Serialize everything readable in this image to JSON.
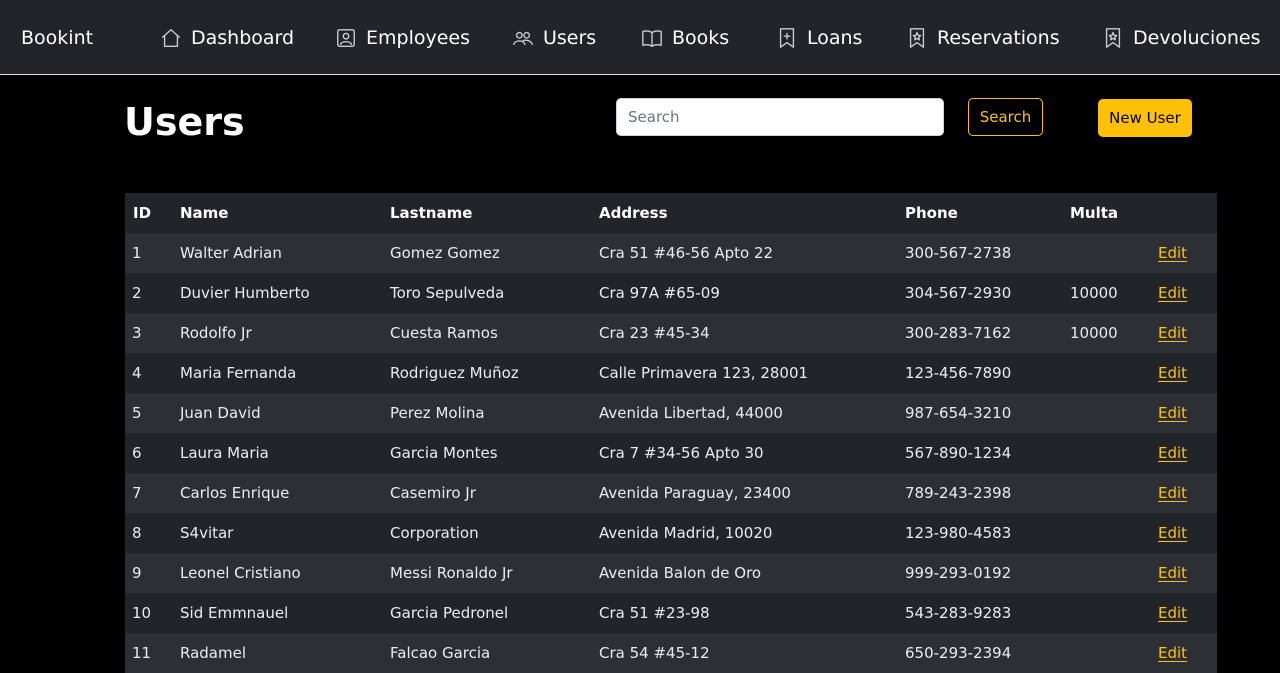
{
  "brand": "Bookint",
  "nav": [
    {
      "label": "Dashboard",
      "icon": "home-icon"
    },
    {
      "label": "Employees",
      "icon": "person-badge-icon"
    },
    {
      "label": "Users",
      "icon": "people-icon"
    },
    {
      "label": "Books",
      "icon": "book-icon"
    },
    {
      "label": "Loans",
      "icon": "bookmark-plus-icon"
    },
    {
      "label": "Reservations",
      "icon": "bookmark-star-icon"
    },
    {
      "label": "Devoluciones",
      "icon": "bookmark-star-icon"
    }
  ],
  "page_title": "Users",
  "search": {
    "placeholder": "Search",
    "value": "",
    "button_label": "Search"
  },
  "new_user_label": "New User",
  "colors": {
    "accent": "#ffc107",
    "navbar": "#212529",
    "row_odd": "#2c3034",
    "row_even": "#212529"
  },
  "table": {
    "headers": [
      "ID",
      "Name",
      "Lastname",
      "Address",
      "Phone",
      "Multa",
      ""
    ],
    "rows": [
      {
        "id": "1",
        "name": "Walter Adrian",
        "lastname": "Gomez Gomez",
        "address": "Cra 51 #46-56 Apto 22",
        "phone": "300-567-2738",
        "multa": "",
        "action": "Edit"
      },
      {
        "id": "2",
        "name": "Duvier Humberto",
        "lastname": "Toro Sepulveda",
        "address": "Cra 97A #65-09",
        "phone": "304-567-2930",
        "multa": "10000",
        "action": "Edit"
      },
      {
        "id": "3",
        "name": "Rodolfo Jr",
        "lastname": "Cuesta Ramos",
        "address": "Cra 23 #45-34",
        "phone": "300-283-7162",
        "multa": "10000",
        "action": "Edit"
      },
      {
        "id": "4",
        "name": "Maria Fernanda",
        "lastname": "Rodriguez Muñoz",
        "address": "Calle Primavera 123, 28001",
        "phone": "123-456-7890",
        "multa": "",
        "action": "Edit"
      },
      {
        "id": "5",
        "name": "Juan David",
        "lastname": "Perez Molina",
        "address": "Avenida Libertad, 44000",
        "phone": "987-654-3210",
        "multa": "",
        "action": "Edit"
      },
      {
        "id": "6",
        "name": "Laura Maria",
        "lastname": "Garcia Montes",
        "address": "Cra 7 #34-56 Apto 30",
        "phone": "567-890-1234",
        "multa": "",
        "action": "Edit"
      },
      {
        "id": "7",
        "name": "Carlos Enrique",
        "lastname": "Casemiro Jr",
        "address": "Avenida Paraguay, 23400",
        "phone": "789-243-2398",
        "multa": "",
        "action": "Edit"
      },
      {
        "id": "8",
        "name": "S4vitar",
        "lastname": "Corporation",
        "address": "Avenida Madrid, 10020",
        "phone": "123-980-4583",
        "multa": "",
        "action": "Edit"
      },
      {
        "id": "9",
        "name": "Leonel Cristiano",
        "lastname": "Messi Ronaldo Jr",
        "address": "Avenida Balon de Oro",
        "phone": "999-293-0192",
        "multa": "",
        "action": "Edit"
      },
      {
        "id": "10",
        "name": "Sid Emmnauel",
        "lastname": "Garcia Pedronel",
        "address": "Cra 51 #23-98",
        "phone": "543-283-9283",
        "multa": "",
        "action": "Edit"
      },
      {
        "id": "11",
        "name": "Radamel",
        "lastname": "Falcao Garcia",
        "address": "Cra 54 #45-12",
        "phone": "650-293-2394",
        "multa": "",
        "action": "Edit"
      }
    ]
  }
}
